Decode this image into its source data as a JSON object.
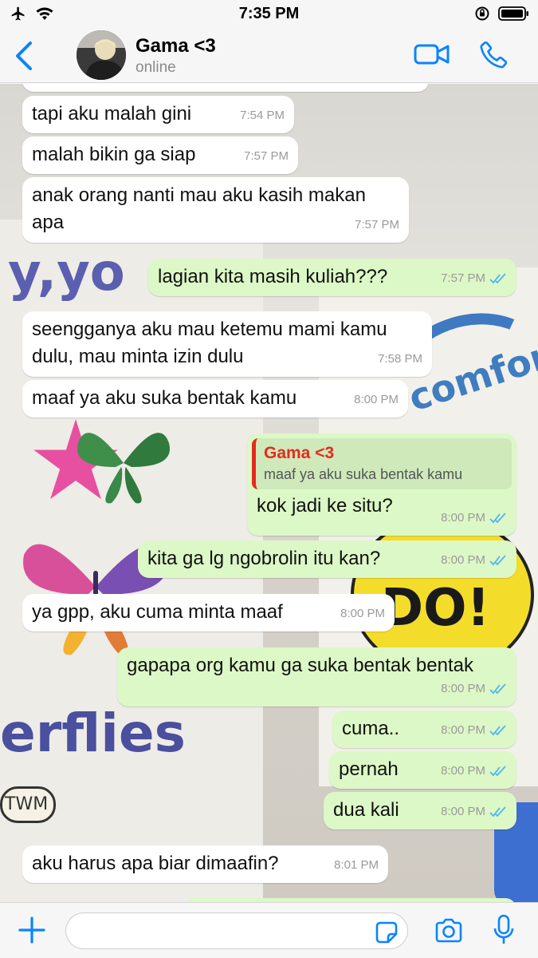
{
  "status_bar": {
    "time": "7:35 PM"
  },
  "header": {
    "contact_name": "Gama <3",
    "contact_status": "online"
  },
  "colors": {
    "accent": "#0a84ff",
    "outgoing_bubble": "#dcf8c6",
    "incoming_bubble": "#ffffff",
    "reply_accent": "#e8291c",
    "read_ticks": "#4fb4f0"
  },
  "messages": [
    {
      "direction": "in",
      "text": "tapi aku malah gini",
      "time": "7:54 PM"
    },
    {
      "direction": "in",
      "text": "malah bikin ga siap",
      "time": "7:57 PM"
    },
    {
      "direction": "in",
      "text": "anak orang nanti mau aku kasih makan apa",
      "time": "7:57 PM"
    },
    {
      "direction": "out",
      "text": "lagian kita masih kuliah???",
      "time": "7:57 PM",
      "status": "read"
    },
    {
      "direction": "in",
      "text": "seengganya aku mau ketemu mami kamu dulu, mau minta izin dulu",
      "time": "7:58 PM"
    },
    {
      "direction": "in",
      "text": "maaf ya aku suka bentak kamu",
      "time": "8:00 PM"
    },
    {
      "direction": "out",
      "text": "kok jadi ke situ?",
      "time": "8:00 PM",
      "status": "read",
      "reply": {
        "name": "Gama <3",
        "text": "maaf ya aku suka bentak kamu"
      }
    },
    {
      "direction": "out",
      "text": "kita ga lg ngobrolin itu kan?",
      "time": "8:00 PM",
      "status": "read"
    },
    {
      "direction": "in",
      "text": "ya gpp, aku cuma minta maaf",
      "time": "8:00 PM"
    },
    {
      "direction": "out",
      "text": "gapapa org kamu ga suka bentak bentak",
      "time": "8:00 PM",
      "status": "read"
    },
    {
      "direction": "out",
      "text": "cuma..",
      "time": "8:00 PM",
      "status": "read"
    },
    {
      "direction": "out",
      "text": "pernah",
      "time": "8:00 PM",
      "status": "read"
    },
    {
      "direction": "out",
      "text": "dua kali",
      "time": "8:00 PM",
      "status": "read"
    },
    {
      "direction": "in",
      "text": "aku harus apa biar dimaafin?",
      "time": "8:01 PM"
    }
  ],
  "wallpaper": {
    "text_1": "y,yo",
    "text_2": "comfor",
    "text_3": "erflies",
    "text_4": "TWM",
    "text_5": "DO!"
  },
  "icons": [
    "back-chevron-icon",
    "video-call-icon",
    "phone-call-icon",
    "plus-icon",
    "sticker-icon",
    "camera-icon",
    "microphone-icon"
  ]
}
